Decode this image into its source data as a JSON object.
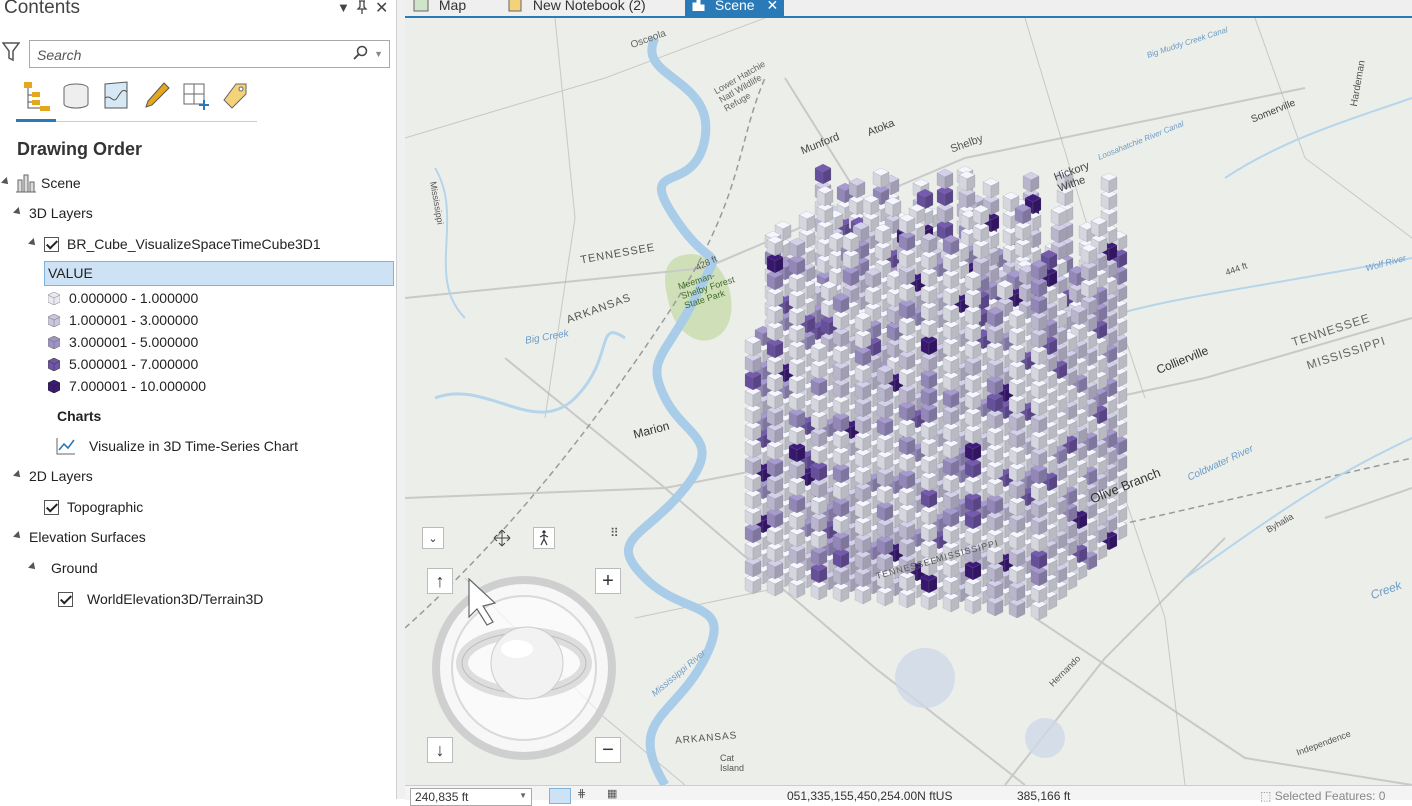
{
  "pane": {
    "title": "Contents",
    "search_placeholder": "Search",
    "heading": "Drawing Order",
    "tree": {
      "scene": "Scene",
      "layers3d": "3D Layers",
      "cube_layer": "BR_Cube_VisualizeSpaceTimeCube3D1",
      "field": "VALUE",
      "legend": [
        "0.000000 - 1.000000",
        "1.000001 - 3.000000",
        "3.000001 - 5.000000",
        "5.000001 - 7.000000",
        "7.000001 - 10.000000"
      ],
      "legend_colors": [
        "#e9e9f2",
        "#c9c6de",
        "#9f93c6",
        "#6f56a8",
        "#3d1a78"
      ],
      "charts": "Charts",
      "chart_item": "Visualize in 3D Time-Series Chart",
      "layers2d": "2D Layers",
      "topographic": "Topographic",
      "elevation": "Elevation Surfaces",
      "ground": "Ground",
      "terrain": "WorldElevation3D/Terrain3D"
    }
  },
  "tabs": [
    {
      "label": "Map",
      "icon": "map-icon"
    },
    {
      "label": "New Notebook (2)",
      "icon": "notebook-icon"
    },
    {
      "label": "Scene",
      "icon": "scene-icon",
      "active": true
    }
  ],
  "map_labels": {
    "osceola": "Osceola",
    "munford": "Munford",
    "atoka": "Atoka",
    "shelby": "Shelby",
    "hickory_withe": "Hickory Withe",
    "somerville": "Somerville",
    "tennessee_w": "TENNESSEE",
    "arkansas": "ARKANSAS",
    "meeman": "Meeman-Shelby Forest State Park",
    "big_creek": "Big Creek",
    "marion": "Marion",
    "collierville": "Collierville",
    "olive_branch": "Olive Branch",
    "tennessee_e": "TENNESSEE",
    "mississippi_e": "MISSISSIPPI",
    "mississippi_river": "Mississippi River",
    "coldwater": "Coldwater River",
    "elev_428": "428 ft",
    "elev_444": "444 ft",
    "arkansas_s": "ARKANSAS",
    "lower_hatchie": "Lower Hatchie Natl Wildlife Refuge",
    "wolf_river": "Wolf River",
    "loosahatchie": "Loosahatchie River Canal",
    "big_muddy": "Big Muddy Creek Canal",
    "creek": "Creek",
    "hernando": "Hernando",
    "independence": "Independence",
    "tennessee_s": "TENNESSEE",
    "mississippi_s": "MISSISSIPPI",
    "byhalia": "Byhalia",
    "cat_island": "Cat Island",
    "mississippi_v": "Mississippi",
    "hardeman": "Hardeman"
  },
  "status": {
    "scale": "240,835 ft",
    "coords": "051,335,155,450,254.00N ftUS",
    "elev": "385,166 ft",
    "selected": "Selected Features: 0"
  }
}
